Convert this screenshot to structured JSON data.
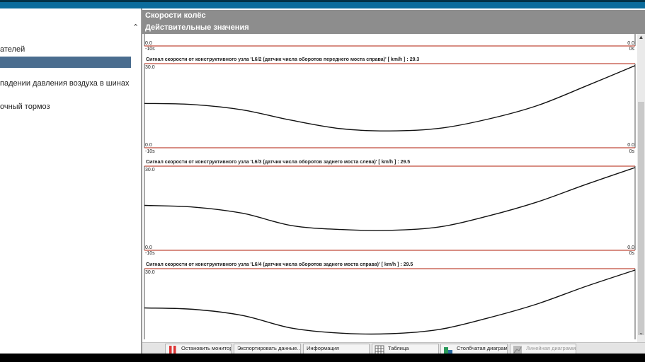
{
  "header": {
    "title": "Скорости колёс",
    "subtitle": "Действительные значения"
  },
  "sidebar": {
    "items": [
      {
        "label": "ателей"
      },
      {
        "label": "падении давления воздуха в шинах"
      },
      {
        "label": "очный тормоз"
      }
    ]
  },
  "plots": [
    {
      "title": "",
      "ymax": "",
      "ymin": "0.0",
      "ymin_right": "0.0",
      "x_left": "-10s",
      "x_right": "0s"
    },
    {
      "title": "Сигнал скорости от конструктивного узла 'L6/2 (датчик числа оборотов переднего моста справа)' [ km/h ] : 29.3",
      "ymax": "30.0",
      "ymin": "0.0",
      "ymin_right": "0.0",
      "x_left": "-10s",
      "x_right": "0s"
    },
    {
      "title": "Сигнал скорости от конструктивного узла 'L6/3 (датчик числа оборотов заднего моста слева)' [ km/h ] : 29.5",
      "ymax": "30.0",
      "ymin": "0.0",
      "ymin_right": "0.0",
      "x_left": "-10s",
      "x_right": "0s"
    },
    {
      "title": "Сигнал скорости от конструктивного узла 'L6/4 (датчик числа оборотов заднего моста справа)' [ km/h ] : 29.5",
      "ymax": "30.0"
    }
  ],
  "chart_data": [
    {
      "type": "line",
      "x": [
        -10,
        -9,
        -8,
        -7,
        -6,
        -5,
        -4,
        -3,
        -2,
        -1,
        0
      ],
      "values": [
        15.8,
        15.4,
        13.5,
        9.8,
        6.8,
        6.0,
        6.9,
        10.2,
        15.0,
        22.0,
        29.3
      ],
      "xlim": [
        -10,
        0
      ],
      "ylim": [
        0,
        30
      ]
    },
    {
      "type": "line",
      "x": [
        -10,
        -9,
        -8,
        -7,
        -6,
        -5,
        -4,
        -3,
        -2,
        -1,
        0
      ],
      "values": [
        16.0,
        15.4,
        13.2,
        8.8,
        7.4,
        7.1,
        8.3,
        12.2,
        17.2,
        23.5,
        29.5
      ],
      "xlim": [
        -10,
        0
      ],
      "ylim": [
        0,
        30
      ]
    },
    {
      "type": "line",
      "x": [
        -10,
        -9,
        -8,
        -7,
        -6,
        -5,
        -4,
        -3,
        -2,
        -1,
        0
      ],
      "values": [
        16.0,
        15.5,
        13.3,
        8.8,
        7.0,
        6.8,
        8.3,
        12.4,
        17.4,
        23.7,
        29.5
      ],
      "xlim": [
        -10,
        0
      ],
      "ylim": [
        0,
        30
      ]
    }
  ],
  "toolbar": {
    "buttons": [
      {
        "label": "Остановить мониторинг",
        "icon": "stop-icon"
      },
      {
        "label": "Экспортировать данные...",
        "icon": ""
      },
      {
        "label": "Информация",
        "icon": ""
      },
      {
        "label": "Таблица",
        "icon": "table-icon"
      },
      {
        "label": "Столбчатая диаграмма",
        "icon": "bar-chart-icon"
      },
      {
        "label": "Линейная диаграмма",
        "icon": "line-chart-icon"
      }
    ]
  },
  "colors": {
    "header_bg": "#8d8d8d",
    "selection_bg": "#4a6d8f",
    "limit_line": "#c04a3a",
    "topbar": "#0b6c9c"
  }
}
